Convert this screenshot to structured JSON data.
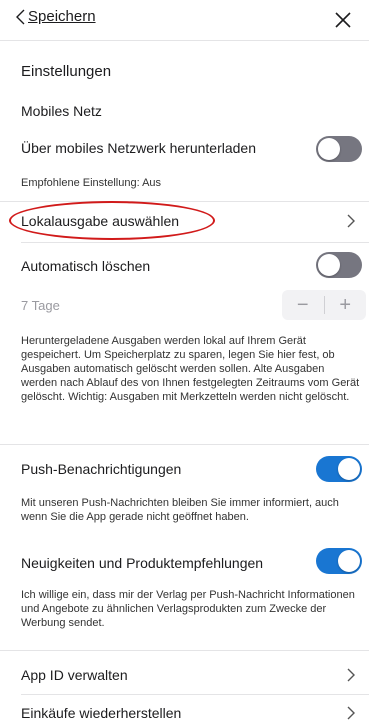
{
  "nav": {
    "back_label": "Speichern",
    "back_icon": "chevron-left-icon",
    "close_icon": "close-icon"
  },
  "settings": {
    "title": "Einstellungen",
    "mobile_section": "Mobiles Netz",
    "mobile_download_label": "Über mobiles Netzwerk herunterladen",
    "mobile_download_on": false,
    "recommended_hint": "Empfohlene Einstellung: Aus",
    "local_edition_label": "Lokalausgabe auswählen",
    "auto_delete_label": "Automatisch löschen",
    "auto_delete_on": false,
    "days_value": "7 Tage",
    "stepper_minus": "−",
    "stepper_plus": "+",
    "auto_delete_description": "Heruntergeladene Ausgaben werden lokal auf Ihrem Gerät gespeichert. Um Speicherplatz zu sparen, legen Sie hier fest, ob Ausgaben automatisch gelöscht werden sollen. Alte Ausgaben werden nach Ablauf des von Ihnen festgelegten Zeitraums vom Gerät gelöscht. Wichtig: Ausgaben mit Merkzetteln werden nicht gelöscht.",
    "push_label": "Push-Benachrichtigungen",
    "push_on": true,
    "push_description": "Mit unseren Push-Nachrichten bleiben Sie immer informiert, auch wenn Sie die App gerade nicht geöffnet haben.",
    "news_label": "Neuigkeiten und Produktempfehlungen",
    "news_on": true,
    "news_description": "Ich willige ein, dass mir der Verlag per Push-Nachricht Informationen und Angebote zu ähnlichen Verlagsprodukten zum Zwecke der Werbung sendet.",
    "app_id_label": "App ID verwalten",
    "restore_label": "Einkäufe wiederherstellen"
  },
  "colors": {
    "toggle_on": "#1976d2",
    "toggle_off": "#767680",
    "annotation": "#d11a1a"
  }
}
